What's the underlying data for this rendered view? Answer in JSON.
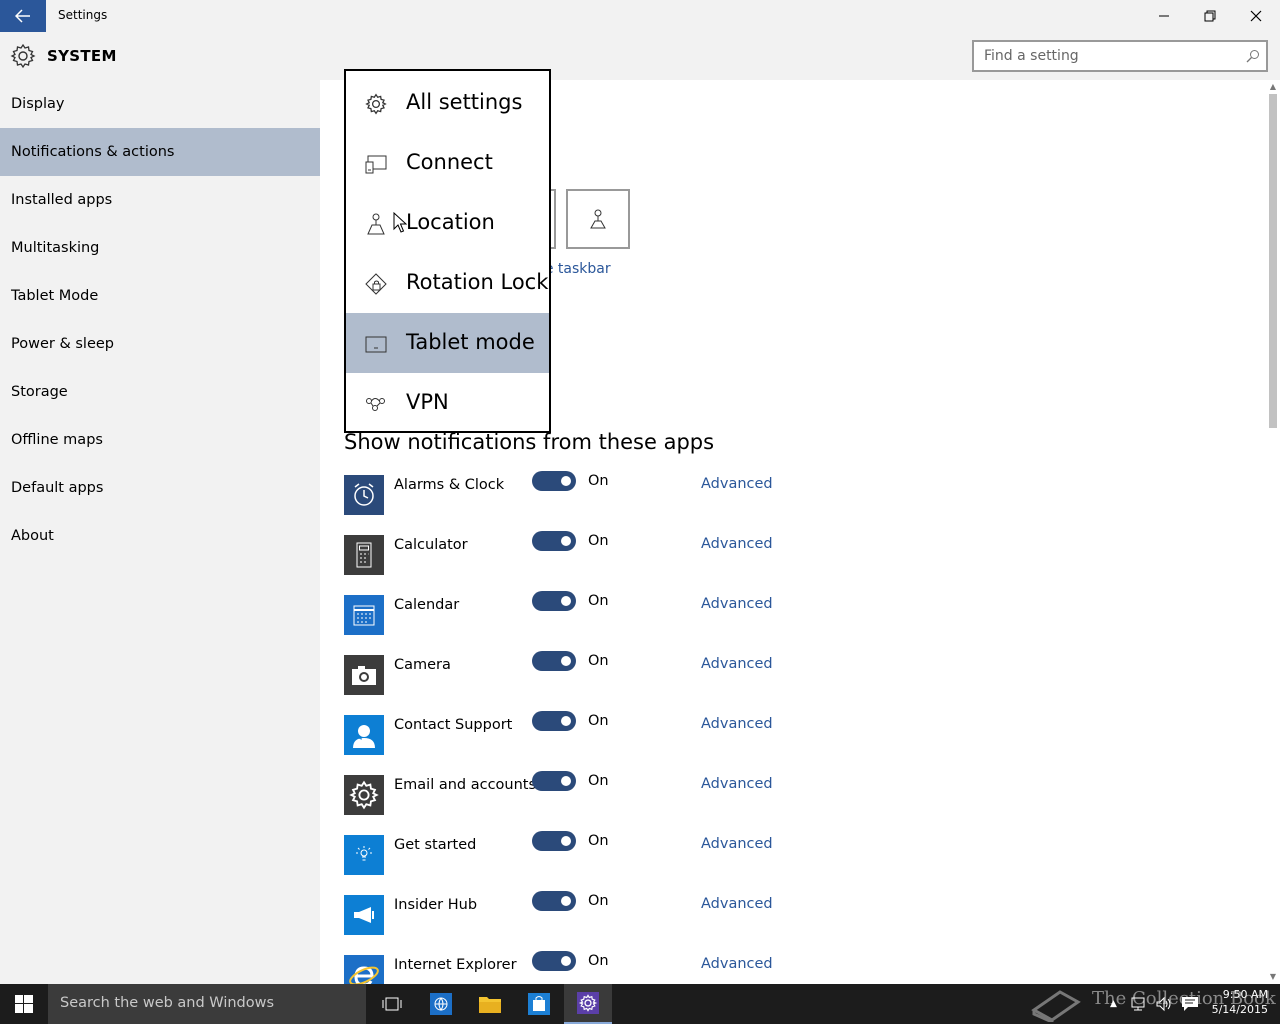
{
  "window": {
    "title": "Settings",
    "minimize_glyph": "–",
    "maximize_glyph": "❐",
    "close_glyph": "✕"
  },
  "header": {
    "section": "SYSTEM",
    "search_placeholder": "Find a setting"
  },
  "sidebar": {
    "items": [
      {
        "label": "Display"
      },
      {
        "label": "Notifications & actions",
        "active": true
      },
      {
        "label": "Installed apps"
      },
      {
        "label": "Multitasking"
      },
      {
        "label": "Tablet Mode"
      },
      {
        "label": "Power & sleep"
      },
      {
        "label": "Storage"
      },
      {
        "label": "Offline maps"
      },
      {
        "label": "Default apps"
      },
      {
        "label": "About"
      }
    ]
  },
  "quick_actions": {
    "link_text": "ne taskbar"
  },
  "dropdown": {
    "items": [
      {
        "label": "All settings",
        "icon": "gear-icon"
      },
      {
        "label": "Connect",
        "icon": "connect-icon"
      },
      {
        "label": "Location",
        "icon": "location-icon"
      },
      {
        "label": "Rotation Lock",
        "icon": "rotation-lock-icon"
      },
      {
        "label": "Tablet mode",
        "icon": "tablet-mode-icon",
        "selected": true
      },
      {
        "label": "VPN",
        "icon": "vpn-icon"
      }
    ]
  },
  "apps_section": {
    "title": "Show notifications from these apps",
    "toggle_label": "On",
    "advanced_label": "Advanced",
    "apps": [
      {
        "name": "Alarms & Clock",
        "icon": "alarm-clock-icon",
        "color": "#2b4a7a"
      },
      {
        "name": "Calculator",
        "icon": "calculator-icon",
        "color": "#3c3c3c"
      },
      {
        "name": "Calendar",
        "icon": "calendar-icon",
        "color": "#1c6fc7"
      },
      {
        "name": "Camera",
        "icon": "camera-icon",
        "color": "#3c3c3c"
      },
      {
        "name": "Contact Support",
        "icon": "contact-support-icon",
        "color": "#0d7fd4"
      },
      {
        "name": "Email and accounts",
        "icon": "gear-icon",
        "color": "#3c3c3c"
      },
      {
        "name": "Get started",
        "icon": "lightbulb-icon",
        "color": "#0d7fd4"
      },
      {
        "name": "Insider Hub",
        "icon": "megaphone-icon",
        "color": "#0d7fd4"
      },
      {
        "name": "Internet Explorer",
        "icon": "internet-explorer-icon",
        "color": "#1c6fc7"
      }
    ]
  },
  "taskbar": {
    "search_text": "Search the web and Windows",
    "watermark": "The Collection Book",
    "time": "9:50 AM",
    "date": "5/14/2015"
  }
}
